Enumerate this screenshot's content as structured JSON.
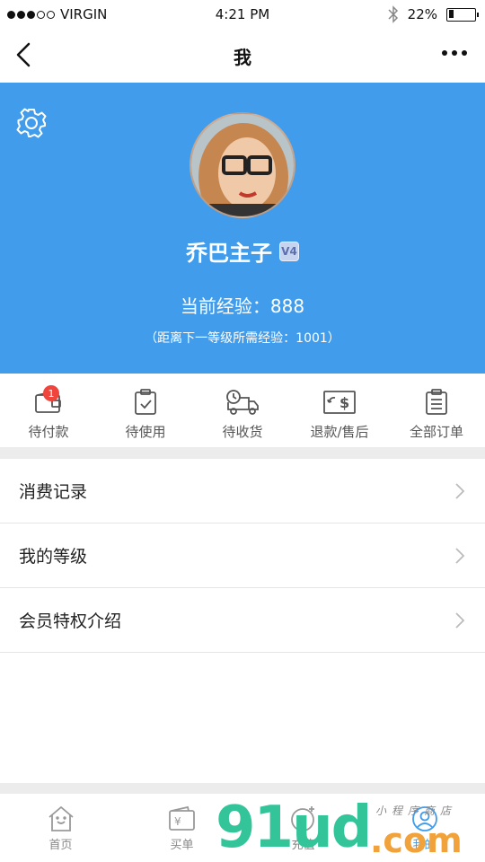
{
  "status_bar": {
    "carrier": "VIRGIN",
    "time": "4:21 PM",
    "battery_percent_label": "22%",
    "battery_level": 0.22
  },
  "nav": {
    "title": "我"
  },
  "profile": {
    "username": "乔巴主子",
    "vip_badge": "V4",
    "experience": "当前经验：888",
    "next_level_hint": "（距离下一等级所需经验：1001）"
  },
  "orders": [
    {
      "label": "待付款",
      "icon": "wallet-icon",
      "badge": "1"
    },
    {
      "label": "待使用",
      "icon": "clipboard-check-icon"
    },
    {
      "label": "待收货",
      "icon": "delivery-truck-icon"
    },
    {
      "label": "退款/售后",
      "icon": "refund-icon"
    },
    {
      "label": "全部订单",
      "icon": "order-list-icon"
    }
  ],
  "menu": [
    {
      "label": "消费记录"
    },
    {
      "label": "我的等级"
    },
    {
      "label": "会员特权介绍"
    }
  ],
  "tabs": [
    {
      "label": "首页",
      "icon": "home-icon"
    },
    {
      "label": "买单",
      "icon": "wallet-yen-icon"
    },
    {
      "label": "充值",
      "icon": "coin-plus-icon"
    },
    {
      "label": "我的",
      "icon": "user-icon",
      "active": true
    }
  ],
  "watermark": {
    "big": "91ud",
    "com": ".com",
    "small": "小程序商店"
  },
  "colors": {
    "primary": "#419DEC",
    "badge": "#F0453D",
    "watermark_green": "#33C49A",
    "watermark_orange": "#F2A23A"
  }
}
